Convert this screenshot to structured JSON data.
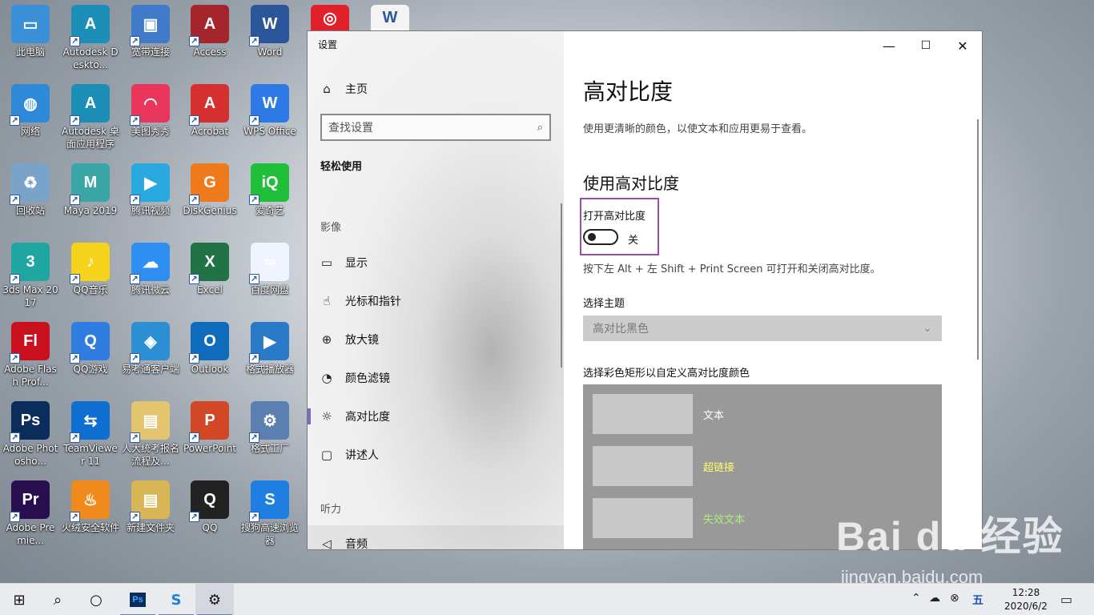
{
  "desktop": {
    "icons": [
      {
        "label": "此电脑",
        "icon": "computer-icon",
        "glyph": "▭",
        "bg": "#3a8fd6"
      },
      {
        "label": "Autodesk Deskto...",
        "icon": "autodesk-icon",
        "glyph": "A",
        "bg": "#1b8fb8"
      },
      {
        "label": "宽带连接",
        "icon": "network-connection-icon",
        "glyph": "▣",
        "bg": "#3f7bc8"
      },
      {
        "label": "Access",
        "icon": "access-icon",
        "glyph": "A",
        "bg": "#a4262c"
      },
      {
        "label": "Word",
        "icon": "word-icon",
        "glyph": "W",
        "bg": "#2b579a"
      },
      {
        "label": "网络",
        "icon": "network-icon",
        "glyph": "◍",
        "bg": "#2e8ad8"
      },
      {
        "label": "Autodesk 桌面应用程序",
        "icon": "autodesk-app-icon",
        "glyph": "A",
        "bg": "#1b8fb8"
      },
      {
        "label": "美图秀秀",
        "icon": "meitu-icon",
        "glyph": "◠",
        "bg": "#e8365d"
      },
      {
        "label": "Acrobat",
        "icon": "acrobat-icon",
        "glyph": "A",
        "bg": "#d62f2f"
      },
      {
        "label": "WPS Office",
        "icon": "wps-icon",
        "glyph": "W",
        "bg": "#2d7ae6"
      },
      {
        "label": "回收站",
        "icon": "recycle-bin-icon",
        "glyph": "♻",
        "bg": "#7aa3c9"
      },
      {
        "label": "Maya 2019",
        "icon": "maya-icon",
        "glyph": "M",
        "bg": "#3aa6a6"
      },
      {
        "label": "腾讯视频",
        "icon": "tencent-video-icon",
        "glyph": "▶",
        "bg": "#2aa9e0"
      },
      {
        "label": "DiskGenius",
        "icon": "diskgenius-icon",
        "glyph": "G",
        "bg": "#ee7a1b"
      },
      {
        "label": "爱奇艺",
        "icon": "iqiyi-icon",
        "glyph": "iQ",
        "bg": "#1fbf3a"
      },
      {
        "label": "3ds Max 2017",
        "icon": "3dsmax-icon",
        "glyph": "3",
        "bg": "#20a6a0"
      },
      {
        "label": "QQ音乐",
        "icon": "qq-music-icon",
        "glyph": "♪",
        "bg": "#f5d31a"
      },
      {
        "label": "腾讯微云",
        "icon": "weiyun-icon",
        "glyph": "☁",
        "bg": "#2e8ff0"
      },
      {
        "label": "Excel",
        "icon": "excel-icon",
        "glyph": "X",
        "bg": "#217346"
      },
      {
        "label": "百度网盘",
        "icon": "baidu-netdisk-icon",
        "glyph": "∞",
        "bg": "#f0f4ff"
      },
      {
        "label": "Adobe Flash Prof...",
        "icon": "flash-icon",
        "glyph": "Fl",
        "bg": "#c8101e"
      },
      {
        "label": "QQ游戏",
        "icon": "qq-game-icon",
        "glyph": "Q",
        "bg": "#2f7de0"
      },
      {
        "label": "易考通客户端",
        "icon": "yikaotong-icon",
        "glyph": "◈",
        "bg": "#2c8fd4"
      },
      {
        "label": "Outlook",
        "icon": "outlook-icon",
        "glyph": "O",
        "bg": "#0f6cbd"
      },
      {
        "label": "格式播放器",
        "icon": "format-player-icon",
        "glyph": "▶",
        "bg": "#2a7ac8"
      },
      {
        "label": "Adobe Photosho...",
        "icon": "photoshop-icon",
        "glyph": "Ps",
        "bg": "#0b2d5b"
      },
      {
        "label": "TeamViewer 11",
        "icon": "teamviewer-icon",
        "glyph": "⇆",
        "bg": "#0e6fd1"
      },
      {
        "label": "人大统考报名流程及...",
        "icon": "folder-icon",
        "glyph": "▤",
        "bg": "#e3c46f"
      },
      {
        "label": "PowerPoint",
        "icon": "powerpoint-icon",
        "glyph": "P",
        "bg": "#d24726"
      },
      {
        "label": "格式工厂",
        "icon": "format-factory-icon",
        "glyph": "⚙",
        "bg": "#5a7fb0"
      },
      {
        "label": "Adobe Premie...",
        "icon": "premiere-icon",
        "glyph": "Pr",
        "bg": "#2a0f4f"
      },
      {
        "label": "火绒安全软件",
        "icon": "huorong-icon",
        "glyph": "♨",
        "bg": "#f08a1c"
      },
      {
        "label": "新建文件夹",
        "icon": "new-folder-icon",
        "glyph": "▤",
        "bg": "#d9b655"
      },
      {
        "label": "QQ",
        "icon": "qq-icon",
        "glyph": "Q",
        "bg": "#222"
      },
      {
        "label": "搜狗高速浏览器",
        "icon": "sogou-browser-icon",
        "glyph": "S",
        "bg": "#1e7fe0"
      }
    ],
    "partial_icons": [
      {
        "icon": "netease-music-icon",
        "glyph": "◎",
        "bg": "#e0202b"
      },
      {
        "icon": "word-doc-icon",
        "glyph": "W",
        "bg": "#f4f4f4"
      }
    ]
  },
  "window": {
    "title": "设置",
    "controls": {
      "minimize": "—",
      "maximize": "☐",
      "close": "✕"
    },
    "nav": {
      "home": "主页",
      "search_placeholder": "查找设置",
      "category": "轻松使用",
      "sections": {
        "vision": "影像",
        "hearing": "听力"
      },
      "items": [
        {
          "label": "显示",
          "icon": "display-icon",
          "glyph": "▭"
        },
        {
          "label": "光标和指针",
          "icon": "pointer-icon",
          "glyph": "☝"
        },
        {
          "label": "放大镜",
          "icon": "magnifier-icon",
          "glyph": "⊕"
        },
        {
          "label": "颜色滤镜",
          "icon": "color-filter-icon",
          "glyph": "◔"
        },
        {
          "label": "高对比度",
          "icon": "contrast-icon",
          "glyph": "☼"
        },
        {
          "label": "讲述人",
          "icon": "narrator-icon",
          "glyph": "▢"
        },
        {
          "label": "音频",
          "icon": "audio-icon",
          "glyph": "◁"
        }
      ]
    },
    "content": {
      "title": "高对比度",
      "description": "使用更清晰的颜色，以使文本和应用更易于查看。",
      "subtitle": "使用高对比度",
      "toggle_label": "打开高对比度",
      "toggle_state": "关",
      "toggle_on": false,
      "hint": "按下左 Alt + 左 Shift + Print Screen 可打开和关闭高对比度。",
      "theme_label": "选择主题",
      "theme_value": "高对比黑色",
      "color_label": "选择彩色矩形以自定义高对比度颜色",
      "color_rows": [
        {
          "label": "文本",
          "color": "#ffffff"
        },
        {
          "label": "超链接",
          "color": "#ffff66"
        },
        {
          "label": "失效文本",
          "color": "#a8f07a"
        }
      ]
    }
  },
  "taskbar": {
    "date": "2020/6/2",
    "time": "12:28",
    "ime": "五"
  },
  "watermark": {
    "logo": "Bai du 经验",
    "url": "jingyan.baidu.com"
  }
}
